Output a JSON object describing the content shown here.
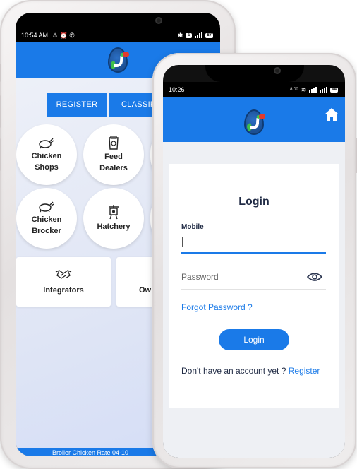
{
  "back_phone": {
    "status": {
      "time": "10:54 AM",
      "battery": "87"
    },
    "tabs": [
      "REGISTER",
      "CLASSIFI"
    ],
    "circle_cards": [
      {
        "label": "Chicken Shops",
        "icon": "chicken-icon"
      },
      {
        "label": "Feed Dealers",
        "icon": "feed-bag-icon"
      },
      {
        "label": "Chicken Brocker",
        "icon": "chicken-icon"
      },
      {
        "label": "Hatchery",
        "icon": "hatchery-icon"
      }
    ],
    "rect_cards": [
      {
        "label": "Integrators",
        "icon": "handshake-icon"
      },
      {
        "label": "Ow"
      }
    ],
    "ticker": "Broiler Chicken Rate 04-10"
  },
  "front_phone": {
    "status": {
      "time": "10:26",
      "speed": "8.00",
      "battery": "94"
    },
    "login": {
      "title": "Login",
      "mobile_label": "Mobile",
      "mobile_value": "",
      "password_placeholder": "Password",
      "forgot_label": "Forgot Password ?",
      "button_label": "Login",
      "signup_text": "Don't have an account yet ? ",
      "register_link": "Register"
    }
  },
  "colors": {
    "primary": "#1a7ae8",
    "text_dark": "#1f2a44"
  }
}
